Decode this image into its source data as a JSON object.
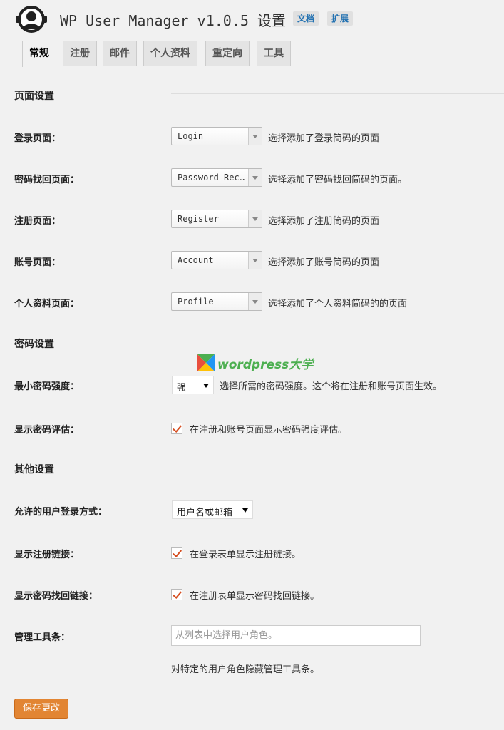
{
  "header": {
    "title": "WP User Manager v1.0.5 设置",
    "docs_label": "文档",
    "addons_label": "扩展"
  },
  "tabs": [
    {
      "label": "常规",
      "active": true
    },
    {
      "label": "注册"
    },
    {
      "label": "邮件"
    },
    {
      "label": "个人资料"
    },
    {
      "label": "重定向"
    },
    {
      "label": "工具"
    }
  ],
  "sections": {
    "pages": "页面设置",
    "password": "密码设置",
    "other": "其他设置"
  },
  "pages": {
    "login": {
      "label": "登录页面：",
      "value": "Login",
      "desc": "选择添加了登录简码的页面"
    },
    "password_recovery": {
      "label": "密码找回页面：",
      "value": "Password Recovery",
      "desc": "选择添加了密码找回简码的页面。"
    },
    "register": {
      "label": "注册页面：",
      "value": "Register",
      "desc": "选择添加了注册简码的页面"
    },
    "account": {
      "label": "账号页面：",
      "value": "Account",
      "desc": "选择添加了账号简码的页面"
    },
    "profile": {
      "label": "个人资料页面：",
      "value": "Profile",
      "desc": "选择添加了个人资料简码的的页面"
    }
  },
  "password": {
    "min_strength": {
      "label": "最小密码强度：",
      "value": "强",
      "desc": "选择所需的密码强度。这个将在注册和账号页面生效。"
    },
    "show_meter": {
      "label": "显示密码评估：",
      "checked": true,
      "text": "在注册和账号页面显示密码强度评估。"
    }
  },
  "other": {
    "login_method": {
      "label": "允许的用户登录方式：",
      "value": "用户名或邮箱"
    },
    "show_register_link": {
      "label": "显示注册链接：",
      "checked": true,
      "text": "在登录表单显示注册链接。"
    },
    "show_recovery_link": {
      "label": "显示密码找回链接：",
      "checked": true,
      "text": "在注册表单显示密码找回链接。"
    },
    "admin_bar": {
      "label": "管理工具条：",
      "placeholder": "从列表中选择用户角色。",
      "desc": "对特定的用户角色隐藏管理工具条。"
    }
  },
  "watermark": {
    "text": "wordpress大学"
  },
  "save_label": "保存更改",
  "colors": {
    "accent": "#e28533",
    "link": "#2271b1",
    "check": "#d54e21"
  }
}
